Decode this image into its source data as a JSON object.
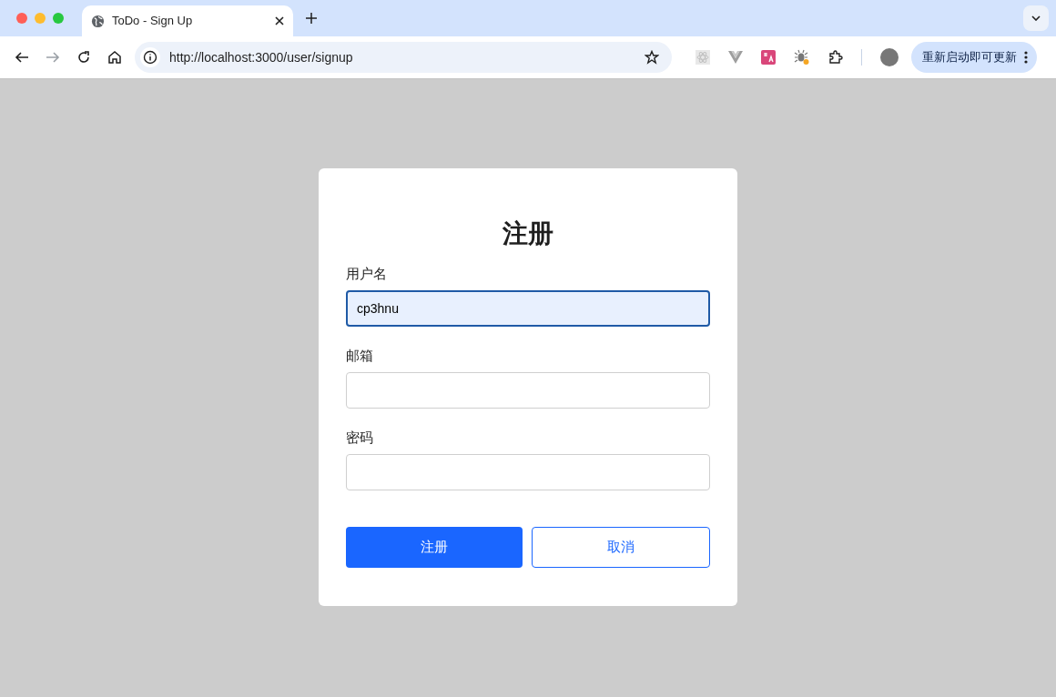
{
  "browser": {
    "tab": {
      "title": "ToDo - Sign Up",
      "selected": true
    },
    "address": "http://localhost:3000/user/signup",
    "update_button": "重新启动即可更新"
  },
  "form": {
    "title": "注册",
    "fields": [
      {
        "label": "用户名",
        "value": "cp3hnu",
        "focused": true
      },
      {
        "label": "邮箱",
        "focused": false
      },
      {
        "label": "密码",
        "focused": false
      }
    ],
    "buttons": [
      {
        "label": "注册",
        "kind": "primary"
      },
      {
        "label": "取消",
        "kind": "secondary"
      }
    ]
  }
}
